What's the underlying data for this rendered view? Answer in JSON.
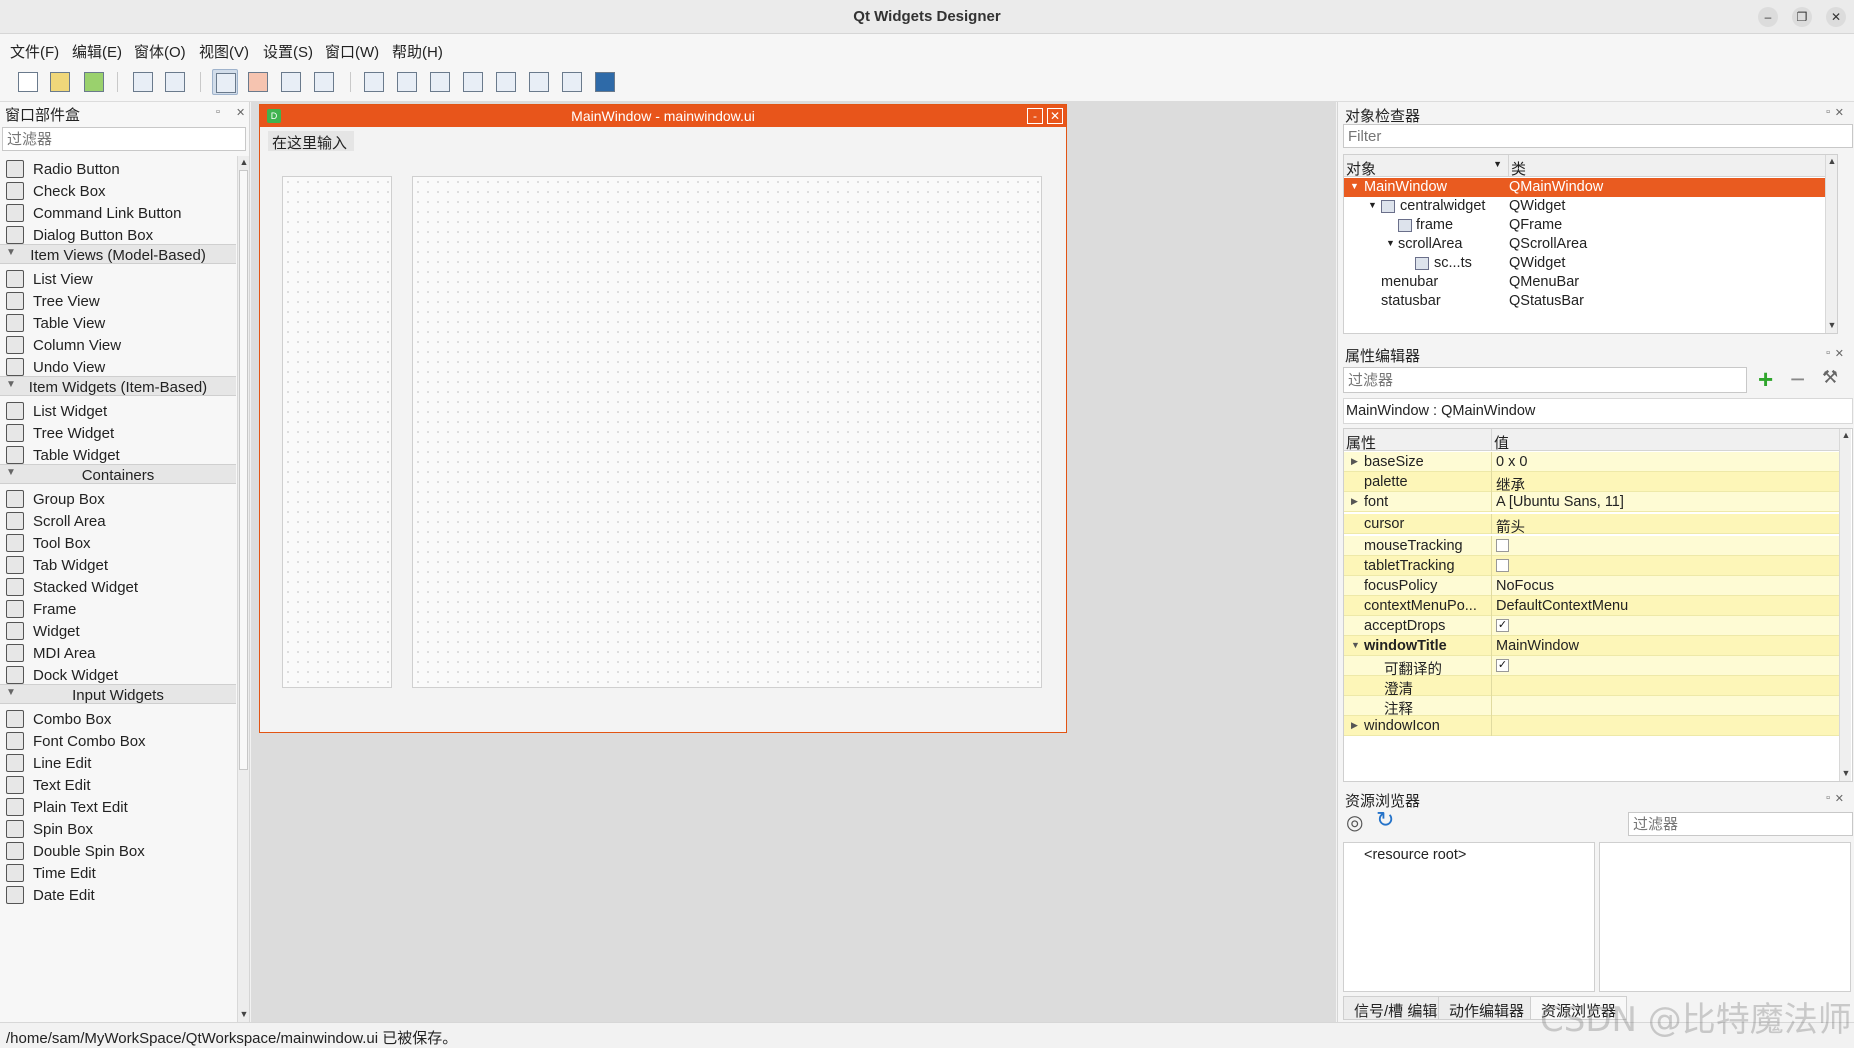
{
  "window": {
    "title": "Qt Widgets Designer"
  },
  "menu": [
    "文件(F)",
    "编辑(E)",
    "窗体(O)",
    "视图(V)",
    "设置(S)",
    "窗口(W)",
    "帮助(H)"
  ],
  "toolbar": [
    "new-file-icon",
    "open-file-icon",
    "save-file-icon",
    "send-to-back-icon",
    "bring-to-front-icon",
    "edit-widgets-icon",
    "edit-signals-slots-icon",
    "edit-buddies-icon",
    "edit-tab-order-icon",
    "layout-horizontal-icon",
    "layout-vertical-icon",
    "splitter-horizontal-icon",
    "splitter-vertical-icon",
    "layout-grid-icon",
    "layout-form-icon",
    "break-layout-icon",
    "adjust-size-icon"
  ],
  "widget_box": {
    "title": "窗口部件盒",
    "filter_placeholder": "过滤器",
    "items": [
      {
        "label": "Radio Button"
      },
      {
        "label": "Check Box"
      },
      {
        "label": "Command Link Button"
      },
      {
        "label": "Dialog Button Box"
      },
      {
        "category": "Item Views (Model-Based)"
      },
      {
        "label": "List View"
      },
      {
        "label": "Tree View"
      },
      {
        "label": "Table View"
      },
      {
        "label": "Column View"
      },
      {
        "label": "Undo View"
      },
      {
        "category": "Item Widgets (Item-Based)"
      },
      {
        "label": "List Widget"
      },
      {
        "label": "Tree Widget"
      },
      {
        "label": "Table Widget"
      },
      {
        "category": "Containers"
      },
      {
        "label": "Group Box"
      },
      {
        "label": "Scroll Area"
      },
      {
        "label": "Tool Box"
      },
      {
        "label": "Tab Widget"
      },
      {
        "label": "Stacked Widget"
      },
      {
        "label": "Frame"
      },
      {
        "label": "Widget"
      },
      {
        "label": "MDI Area"
      },
      {
        "label": "Dock Widget"
      },
      {
        "category": "Input Widgets"
      },
      {
        "label": "Combo Box"
      },
      {
        "label": "Font Combo Box"
      },
      {
        "label": "Line Edit"
      },
      {
        "label": "Text Edit"
      },
      {
        "label": "Plain Text Edit"
      },
      {
        "label": "Spin Box"
      },
      {
        "label": "Double Spin Box"
      },
      {
        "label": "Time Edit"
      },
      {
        "label": "Date Edit"
      }
    ]
  },
  "form": {
    "title": "MainWindow - mainwindow.ui",
    "menu_placeholder": "在这里输入"
  },
  "object_inspector": {
    "title": "对象检查器",
    "filter_placeholder": "Filter",
    "col_object": "对象",
    "col_class": "类",
    "rows": [
      {
        "object": "MainWindow",
        "class": "QMainWindow",
        "selected": true
      },
      {
        "object": "centralwidget",
        "class": "QWidget"
      },
      {
        "object": "frame",
        "class": "QFrame"
      },
      {
        "object": "scrollArea",
        "class": "QScrollArea"
      },
      {
        "object": "sc...ts",
        "class": "QWidget"
      },
      {
        "object": "menubar",
        "class": "QMenuBar"
      },
      {
        "object": "statusbar",
        "class": "QStatusBar"
      }
    ]
  },
  "property_editor": {
    "title": "属性编辑器",
    "filter_placeholder": "过滤器",
    "context": "MainWindow : QMainWindow",
    "col_property": "属性",
    "col_value": "值",
    "rows": [
      {
        "name": "baseSize",
        "value": "0 x 0",
        "expandable": true
      },
      {
        "name": "palette",
        "value": "继承"
      },
      {
        "name": "font",
        "value": "A [Ubuntu Sans, 11]",
        "expandable": true
      },
      {
        "name": "cursor",
        "value": "箭头"
      },
      {
        "name": "mouseTracking",
        "checked": false
      },
      {
        "name": "tabletTracking",
        "checked": false
      },
      {
        "name": "focusPolicy",
        "value": "NoFocus"
      },
      {
        "name": "contextMenuPo...",
        "value": "DefaultContextMenu"
      },
      {
        "name": "acceptDrops",
        "checked": true
      },
      {
        "name": "windowTitle",
        "value": "MainWindow",
        "bold": true,
        "expanded": true
      },
      {
        "name": "可翻译的",
        "checked": true,
        "sub": true
      },
      {
        "name": "澄清",
        "value": "",
        "sub": true
      },
      {
        "name": "注释",
        "value": "",
        "sub": true
      },
      {
        "name": "windowIcon",
        "value": "",
        "expandable": true
      }
    ]
  },
  "resource_browser": {
    "title": "资源浏览器",
    "filter_placeholder": "过滤器",
    "root": "<resource root>",
    "tabs": [
      "信号/槽 编辑器",
      "动作编辑器",
      "资源浏览器"
    ]
  },
  "status": {
    "message": "/home/sam/MyWorkSpace/QtWorkspace/mainwindow.ui 已被保存。"
  },
  "watermark": "CSDN @比特魔法师",
  "colors": {
    "accent": "#e95b20",
    "property_row": "#fefbd4"
  }
}
